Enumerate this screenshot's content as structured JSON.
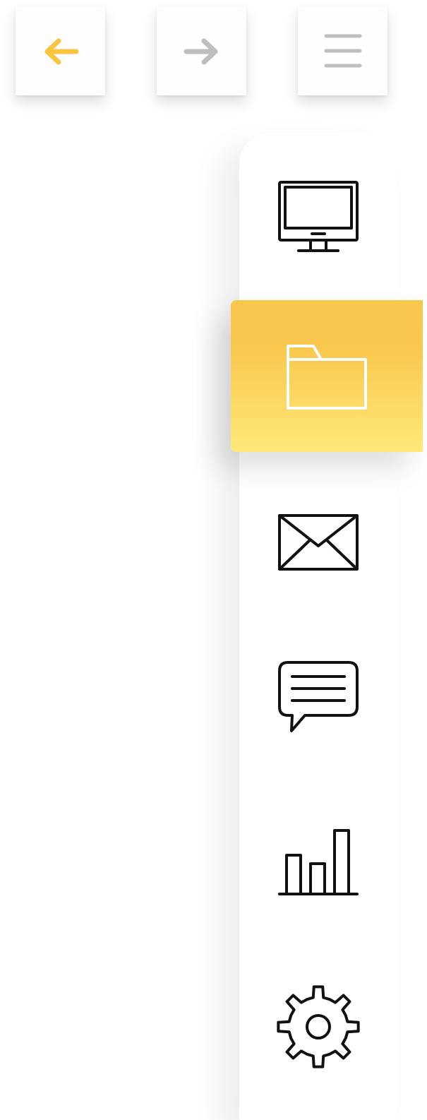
{
  "toolbar": {
    "buttons": [
      {
        "id": "back",
        "icon": "arrow-left-icon",
        "color": "#F9C53F"
      },
      {
        "id": "forward",
        "icon": "arrow-right-icon",
        "color": "#BEBEBE"
      },
      {
        "id": "menu",
        "icon": "hamburger-menu-icon",
        "color": "#BEBEBE"
      }
    ]
  },
  "sidebar": {
    "items": [
      {
        "id": "computer",
        "icon": "monitor-icon",
        "active": false
      },
      {
        "id": "files",
        "icon": "folder-icon",
        "active": true
      },
      {
        "id": "mail",
        "icon": "envelope-icon",
        "active": false
      },
      {
        "id": "messages",
        "icon": "chat-bubble-icon",
        "active": false
      },
      {
        "id": "statistics",
        "icon": "bar-chart-icon",
        "active": false
      },
      {
        "id": "settings",
        "icon": "gear-icon",
        "active": false
      }
    ]
  },
  "colors": {
    "accent": "#F9C53F",
    "accent_gradient_top": "#F9C74D",
    "accent_gradient_bottom": "#FFE97A",
    "icon_default": "#111111",
    "icon_active": "#FFFFFF",
    "muted": "#BEBEBE"
  }
}
